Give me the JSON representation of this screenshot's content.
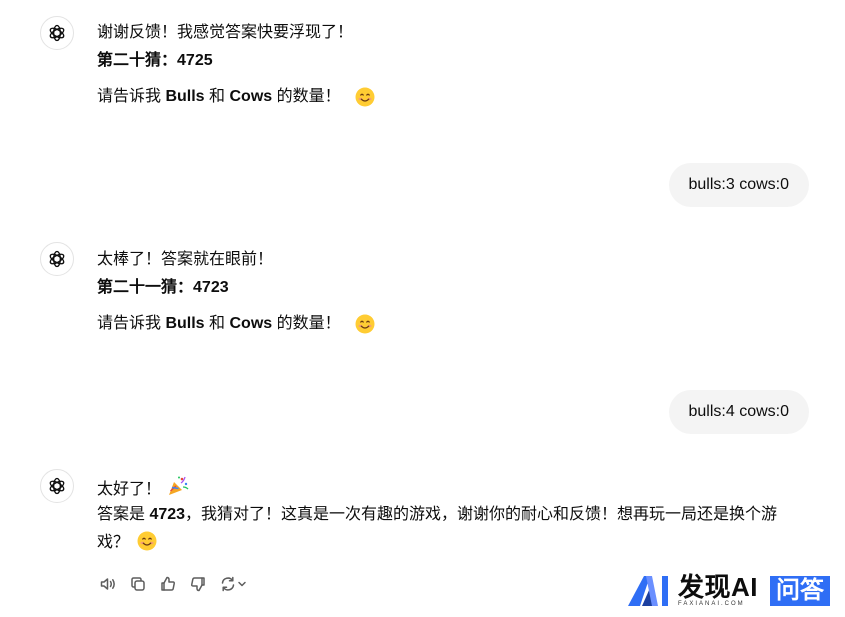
{
  "messages": [
    {
      "line1": "谢谢反馈！我感觉答案快要浮现了！",
      "guess_label": "第二十猜：",
      "guess_value": "4725",
      "prompt_pre": "请告诉我 ",
      "bulls": "Bulls",
      "and": " 和 ",
      "cows": "Cows",
      "prompt_post": " 的数量！"
    },
    {
      "user": "bulls:3 cows:0"
    },
    {
      "line1": "太棒了！答案就在眼前！",
      "guess_label": "第二十一猜：",
      "guess_value": "4723",
      "prompt_pre": "请告诉我 ",
      "bulls": "Bulls",
      "and": " 和 ",
      "cows": "Cows",
      "prompt_post": " 的数量！"
    },
    {
      "user": "bulls:4 cows:0"
    },
    {
      "line1": "太好了！",
      "answer_pre": "答案是 ",
      "answer_value": "4723",
      "answer_post1": "，我猜对了！这真是一次有趣的游戏，谢谢你的耐心和反馈！想再玩一局还是换个游",
      "answer_post2": "戏？"
    }
  ],
  "icons": {
    "avatar": "openai-logo-icon",
    "smile": "smiling-face-emoji-icon",
    "party": "party-popper-emoji-icon",
    "read_aloud": "speaker-icon",
    "copy": "copy-icon",
    "thumbs_up": "thumbs-up-icon",
    "thumbs_down": "thumbs-down-icon",
    "regenerate": "regenerate-icon"
  },
  "watermark": {
    "title": "发现AI",
    "subtitle": "FAXIANAI.COM",
    "badge": "问答"
  },
  "colors": {
    "bubble": "#f4f4f4",
    "text": "#0d0d0d",
    "icon": "#5d5d5d",
    "brand_blue": "#2f6ef5"
  }
}
